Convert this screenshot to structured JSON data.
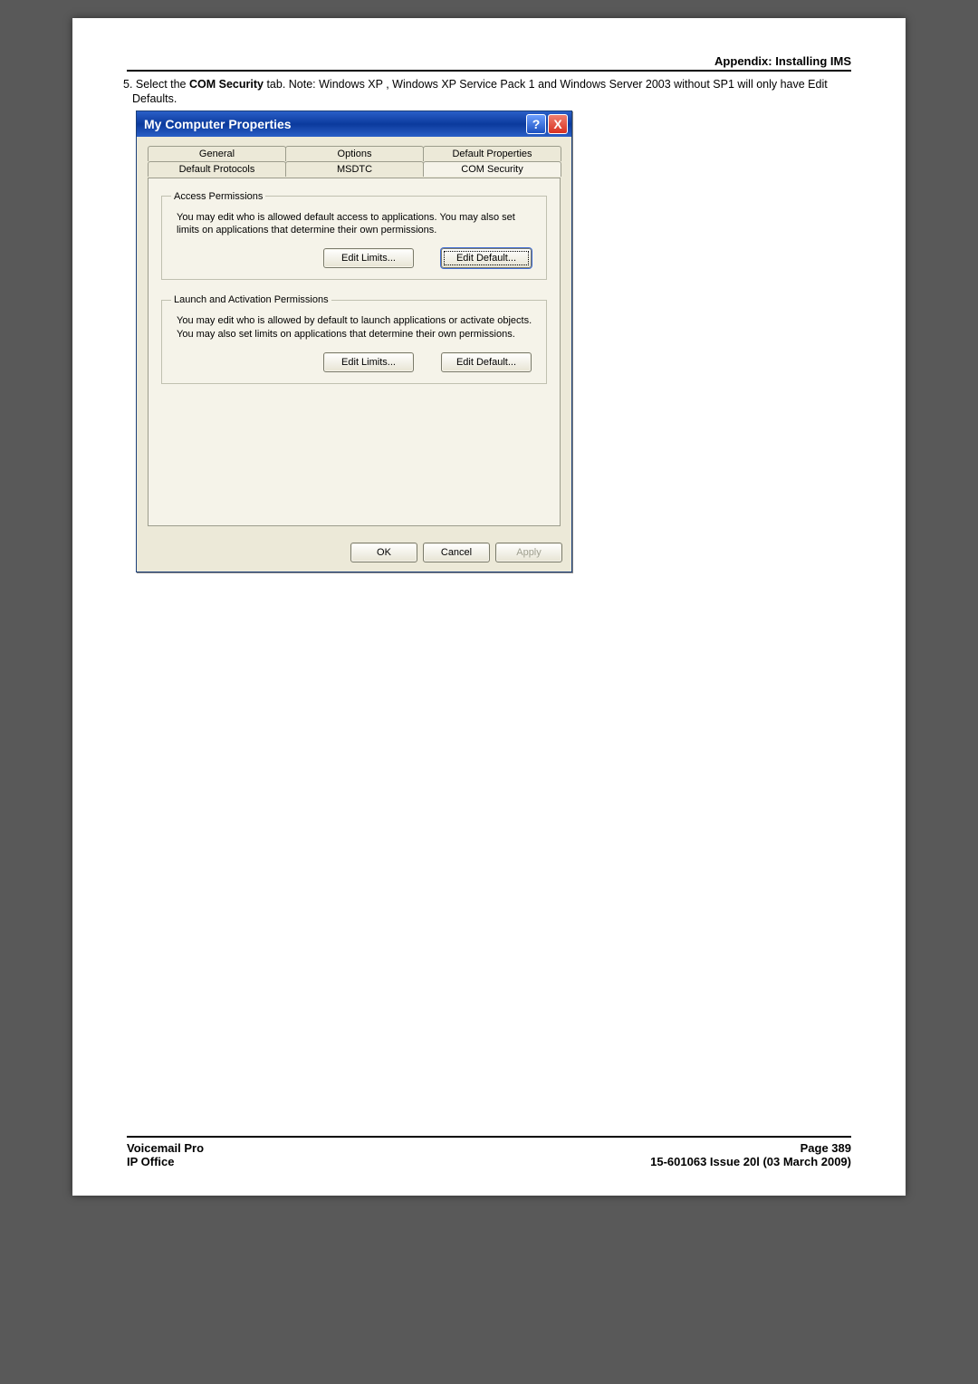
{
  "header": {
    "appendix": "Appendix: Installing IMS"
  },
  "instruction": {
    "number": "5.",
    "prefix": "Select the ",
    "bold": "COM Security",
    "suffix": " tab. Note: Windows XP , Windows XP Service Pack 1 and Windows Server 2003 without SP1 will only have Edit Defaults."
  },
  "dialog": {
    "title": "My Computer Properties",
    "help_glyph": "?",
    "close_glyph": "X",
    "tabs_row1": [
      "General",
      "Options",
      "Default Properties"
    ],
    "tabs_row2": [
      "Default Protocols",
      "MSDTC",
      "COM Security"
    ],
    "access": {
      "legend": "Access Permissions",
      "text": "You may edit who is allowed default access to applications. You may also set limits on applications that determine their own permissions.",
      "edit_limits": "Edit Limits...",
      "edit_default": "Edit Default..."
    },
    "launch": {
      "legend": "Launch and Activation Permissions",
      "text": "You may edit who is allowed by default to launch applications or activate objects. You may also set limits on applications that determine their own permissions.",
      "edit_limits": "Edit Limits...",
      "edit_default": "Edit Default..."
    },
    "buttons": {
      "ok": "OK",
      "cancel": "Cancel",
      "apply": "Apply"
    }
  },
  "footer": {
    "left1": "Voicemail Pro",
    "right1": "Page 389",
    "left2": "IP Office",
    "right2": "15-601063 Issue 20l (03 March 2009)"
  }
}
